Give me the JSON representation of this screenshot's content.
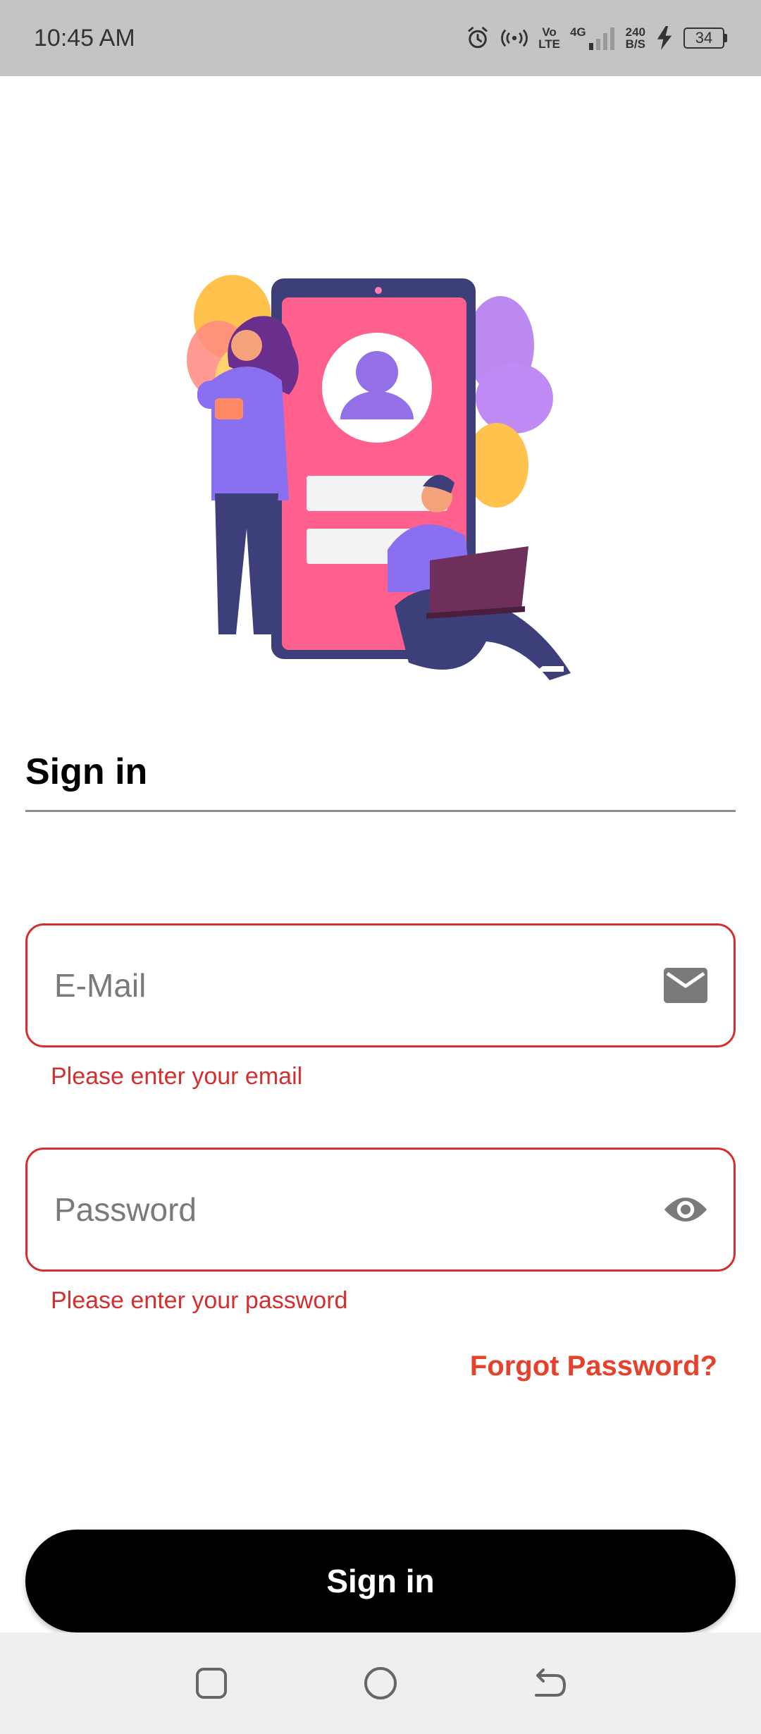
{
  "status_bar": {
    "time": "10:45 AM",
    "volte_top": "Vo",
    "volte_bottom": "LTE",
    "network": "4G",
    "speed_top": "240",
    "speed_bottom": "B/S",
    "battery": "34"
  },
  "page": {
    "title": "Sign in"
  },
  "email_field": {
    "placeholder": "E-Mail",
    "value": "",
    "error": "Please enter your email",
    "icon": "mail-icon"
  },
  "password_field": {
    "placeholder": "Password",
    "value": "",
    "error": "Please enter your password",
    "icon": "eye-icon"
  },
  "forgot_password_label": "Forgot Password?",
  "signin_button_label": "Sign in",
  "colors": {
    "error": "#d32f2f",
    "accent": "#e8412b",
    "button_bg": "#000000"
  },
  "nav_bar": {
    "icons": [
      "recent-apps-icon",
      "home-icon",
      "back-icon"
    ]
  }
}
